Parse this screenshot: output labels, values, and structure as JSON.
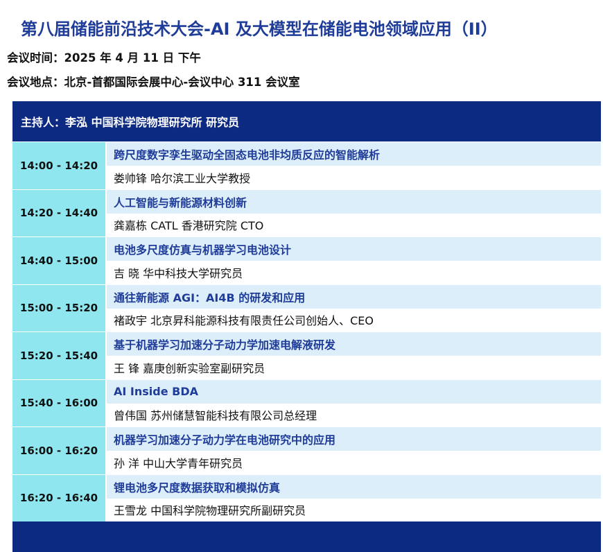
{
  "title": "第八届储能前沿技术大会-AI 及大模型在储能电池领域应用（II）",
  "meeting_time": "会议时间：2025 年 4 月 11 日  下午",
  "meeting_place": "会议地点：北京-首都国际会展中心-会议中心 311 会议室",
  "host": "主持人：李泓  中国科学院物理研究所 研究员",
  "sessions": [
    {
      "time": "14:00 - 14:20",
      "topic": "跨尺度数字孪生驱动全固态电池非均质反应的智能解析",
      "speaker": "娄帅锋   哈尔滨工业大学教授"
    },
    {
      "time": "14:20 - 14:40",
      "topic": "人工智能与新能源材料创新",
      "speaker": "龚嘉栋   CATL 香港研究院 CTO"
    },
    {
      "time": "14:40 - 15:00",
      "topic": "电池多尺度仿真与机器学习电池设计",
      "speaker": "吉   晓   华中科技大学研究员"
    },
    {
      "time": "15:00 - 15:20",
      "topic": "通往新能源 AGI：AI4B 的研发和应用",
      "speaker": "褚政宇   北京昇科能源科技有限责任公司创始人、CEO"
    },
    {
      "time": "15:20 - 15:40",
      "topic": "基于机器学习加速分子动力学加速电解液研发",
      "speaker": "王   锋   嘉庚创新实验室副研究员"
    },
    {
      "time": "15:40 - 16:00",
      "topic": "AI Inside BDA",
      "speaker": "曾伟国   苏州储慧智能科技有限公司总经理"
    },
    {
      "time": "16:00 - 16:20",
      "topic": "机器学习加速分子动力学在电池研究中的应用",
      "speaker": "孙   洋   中山大学青年研究员"
    },
    {
      "time": "16:20 - 16:40",
      "topic": "锂电池多尺度数据获取和模拟仿真",
      "speaker": "王雪龙   中国科学院物理研究所副研究员"
    }
  ]
}
